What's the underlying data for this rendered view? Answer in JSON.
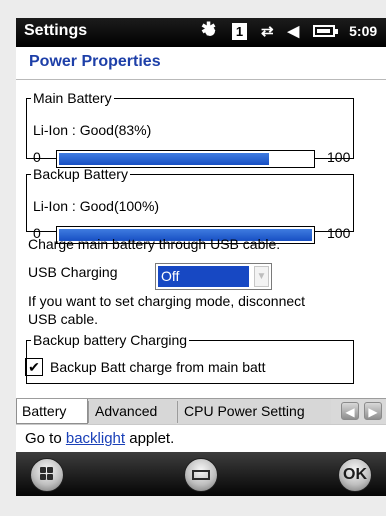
{
  "status_bar": {
    "title": "Settings",
    "icons": [
      "sun-icon",
      "profile-one-icon",
      "network-icon",
      "speaker-icon",
      "battery-icon"
    ],
    "profile_number": "1",
    "time": "5:09"
  },
  "header": {
    "title": "Power Properties"
  },
  "main_battery": {
    "legend": "Main Battery",
    "status": "Li-Ion : Good(83%)",
    "min_label": "0",
    "max_label": "100",
    "level": 0.83
  },
  "backup_battery": {
    "legend": "Backup Battery",
    "status": "Li-Ion : Good(100%)",
    "min_label": "0",
    "max_label": "100",
    "level": 1.0
  },
  "usb": {
    "info": "Charge main battery through USB cable.",
    "label": "USB Charging",
    "selected_value": "Off",
    "note_line1": "If you want to set charging mode, disconnect",
    "note_line2": "USB cable."
  },
  "backup_charging": {
    "legend": "Backup battery Charging",
    "checkbox_label": "Backup Batt charge from main batt",
    "checked": true
  },
  "tabs": [
    {
      "label": "Battery",
      "active": true
    },
    {
      "label": "Advanced",
      "active": false
    },
    {
      "label": "CPU Power Setting",
      "active": false
    }
  ],
  "link_line": {
    "prefix": "Go to ",
    "link": "backlight",
    "suffix": " applet."
  },
  "softkeys": {
    "left_icon": "windows-start-icon",
    "center_icon": "keyboard-icon",
    "right_label": "OK"
  }
}
